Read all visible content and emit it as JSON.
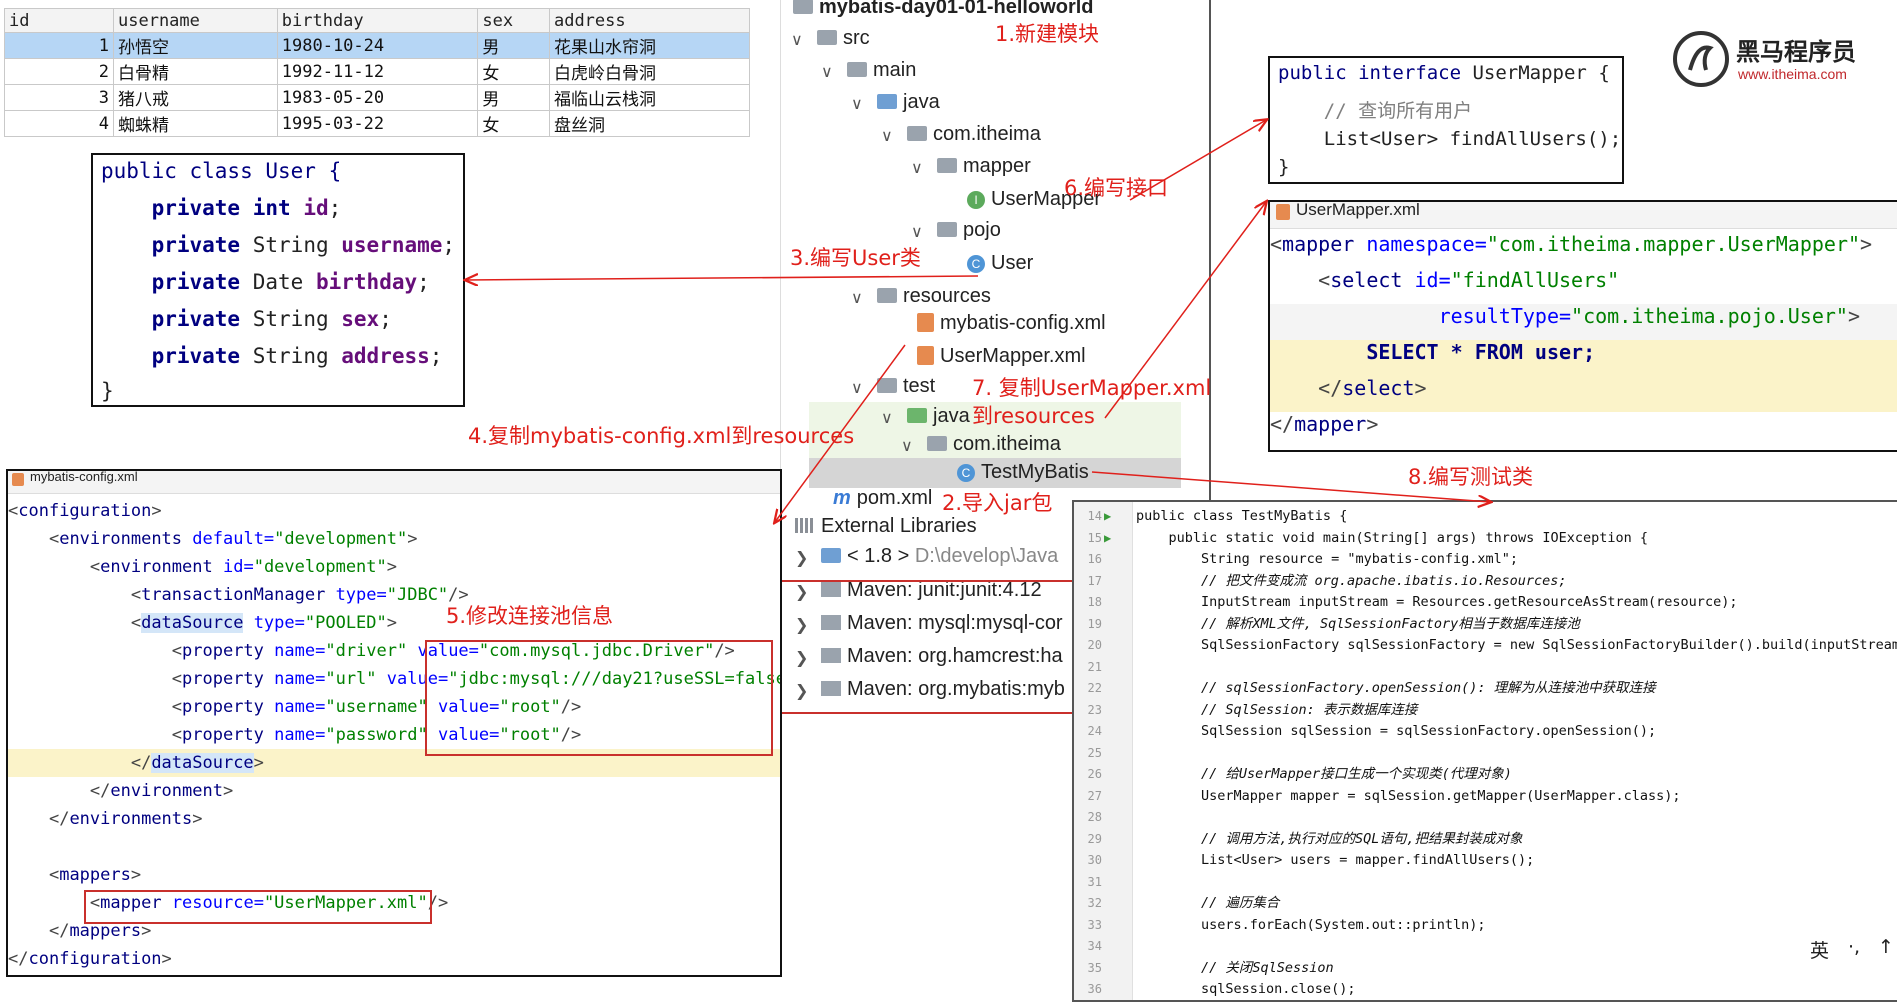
{
  "db_table": {
    "headers": [
      "id",
      "username",
      "birthday",
      "sex",
      "address"
    ],
    "rows": [
      [
        "1",
        "孙悟空",
        "1980-10-24",
        "男",
        "花果山水帘洞"
      ],
      [
        "2",
        "白骨精",
        "1992-11-12",
        "女",
        "白虎岭白骨洞"
      ],
      [
        "3",
        "猪八戒",
        "1983-05-20",
        "男",
        "福临山云栈洞"
      ],
      [
        "4",
        "蜘蛛精",
        "1995-03-22",
        "女",
        "盘丝洞"
      ]
    ]
  },
  "user_class": {
    "decl": "public class User {",
    "fields": [
      {
        "mod": "private",
        "type": "int",
        "name": "id"
      },
      {
        "mod": "private",
        "type": "String",
        "name": "username"
      },
      {
        "mod": "private",
        "type": "Date",
        "name": "birthday"
      },
      {
        "mod": "private",
        "type": "String",
        "name": "sex"
      },
      {
        "mod": "private",
        "type": "String",
        "name": "address"
      }
    ],
    "close": "}"
  },
  "project_tree": {
    "module": "mybatis-day01-01-helloworld",
    "src": "src",
    "main": "main",
    "java": "java",
    "pkg": "com.itheima",
    "mapper_pkg": "mapper",
    "usermapper": "UserMapper",
    "pojo_pkg": "pojo",
    "user": "User",
    "resources": "resources",
    "cfg_xml": "mybatis-config.xml",
    "mapper_xml": "UserMapper.xml",
    "test": "test",
    "test_java": "java",
    "test_pkg": "com.itheima",
    "testclass": "TestMyBatis",
    "pom": "pom.xml",
    "ext_libs": "External Libraries",
    "jdk": "< 1.8 >",
    "jdk_path": "D:\\develop\\Java",
    "maven": [
      "Maven: junit:junit:4.12",
      "Maven: mysql:mysql-cor",
      "Maven: org.hamcrest:ha",
      "Maven: org.mybatis:myb"
    ]
  },
  "annotations": {
    "a1": "1.新建模块",
    "a2": "2.导入jar包",
    "a3": "3.编写User类",
    "a4": "4.复制mybatis-config.xml到resources",
    "a5": "5.修改连接池信息",
    "a6": "6.编写接口",
    "a7a": "7. 复制UserMapper.xml",
    "a7b": "到resources",
    "a8": "8.编写测试类"
  },
  "usermapper_interface": {
    "line1_kw": "public interface",
    "line1_name": "UserMapper {",
    "comment": "// 查询所有用户",
    "method": "List<User> findAllUsers();",
    "close": "}"
  },
  "usermapper_xml": {
    "tab_title": "UserMapper.xml",
    "namespace": "\"com.itheima.mapper.UserMapper\"",
    "select_id": "\"findAllUsers\"",
    "result_type": "\"com.itheima.pojo.User\"",
    "sql": "SELECT * FROM user;"
  },
  "config_xml": {
    "tab_title": "mybatis-config.xml",
    "environments_default": "\"development\"",
    "environment_id": "\"development\"",
    "tx_type": "\"JDBC\"",
    "ds_type": "\"POOLED\"",
    "props": [
      {
        "name": "\"driver\"",
        "value": "\"com.mysql.jdbc.Driver\""
      },
      {
        "name": "\"url\"",
        "value": "\"jdbc:mysql:///day21?useSSL=false\""
      },
      {
        "name": "\"username\"",
        "value": "\"root\""
      },
      {
        "name": "\"password\"",
        "value": "\"root\""
      }
    ],
    "mapper_resource": "\"UserMapper.xml\""
  },
  "test_code": {
    "line_numbers": [
      "14",
      "15",
      "16",
      "17",
      "18",
      "19",
      "20",
      "21",
      "22",
      "23",
      "24",
      "25",
      "26",
      "27",
      "28",
      "29",
      "30",
      "31",
      "32",
      "33",
      "34",
      "35",
      "36"
    ],
    "lines": [
      "public class TestMyBatis {",
      "    public static void main(String[] args) throws IOException {",
      "        String resource = \"mybatis-config.xml\";",
      "        // 把文件变成流 org.apache.ibatis.io.Resources;",
      "        InputStream inputStream = Resources.getResourceAsStream(resource);",
      "        // 解析XML文件, SqlSessionFactory相当于数据库连接池",
      "        SqlSessionFactory sqlSessionFactory = new SqlSessionFactoryBuilder().build(inputStream);",
      "",
      "        // sqlSessionFactory.openSession(): 理解为从连接池中获取连接",
      "        // SqlSession: 表示数据库连接",
      "        SqlSession sqlSession = sqlSessionFactory.openSession();",
      "",
      "        // 给UserMapper接口生成一个实现类(代理对象)",
      "        UserMapper mapper = sqlSession.getMapper(UserMapper.class);",
      "",
      "        // 调用方法,执行对应的SQL语句,把结果封装成对象",
      "        List<User> users = mapper.findAllUsers();",
      "",
      "        // 遍历集合",
      "        users.forEach(System.out::println);",
      "",
      "        // 关闭SqlSession",
      "        sqlSession.close();"
    ]
  },
  "logo": {
    "name": "黑马程序员",
    "url": "www.itheima.com"
  },
  "ime": {
    "label": "英"
  },
  "colors": {
    "annotation": "#e0201b",
    "selected_row": "#b6d6f5",
    "xml_highlight": "#fbf3c9"
  }
}
